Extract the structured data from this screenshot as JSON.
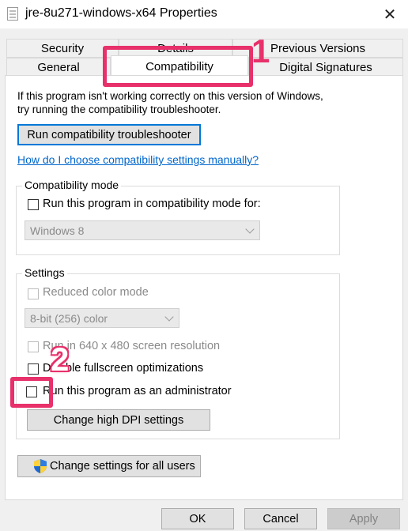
{
  "window": {
    "title": "jre-8u271-windows-x64 Properties",
    "close_glyph": "✕"
  },
  "tabs": {
    "row_back": [
      "Security",
      "Details",
      "Previous Versions"
    ],
    "row_front": [
      "General",
      "Compatibility",
      "Digital Signatures"
    ],
    "active": "Compatibility"
  },
  "compat": {
    "intro_line1": "If this program isn't working correctly on this version of Windows,",
    "intro_line2": "try running the compatibility troubleshooter.",
    "troubleshooter_button": "Run compatibility troubleshooter",
    "help_link": "How do I choose compatibility settings manually?",
    "mode_group": {
      "label": "Compatibility mode",
      "checkbox_label": "Run this program in compatibility mode for:",
      "select_value": "Windows 8"
    },
    "settings_group": {
      "label": "Settings",
      "reduced_color": "Reduced color mode",
      "color_select_value": "8-bit (256) color",
      "run_640": "Run in 640 x 480 screen resolution",
      "disable_fullscreen": "Disable fullscreen optimizations",
      "run_admin": "Run this program as an administrator",
      "dpi_button": "Change high DPI settings"
    },
    "all_users_button": "Change settings for all users"
  },
  "footer": {
    "ok": "OK",
    "cancel": "Cancel",
    "apply": "Apply"
  },
  "annotations": {
    "step1": "1",
    "step2": "2"
  },
  "colors": {
    "annotation": "#e8306b",
    "link": "#0066cc",
    "focus": "#0078d7"
  }
}
